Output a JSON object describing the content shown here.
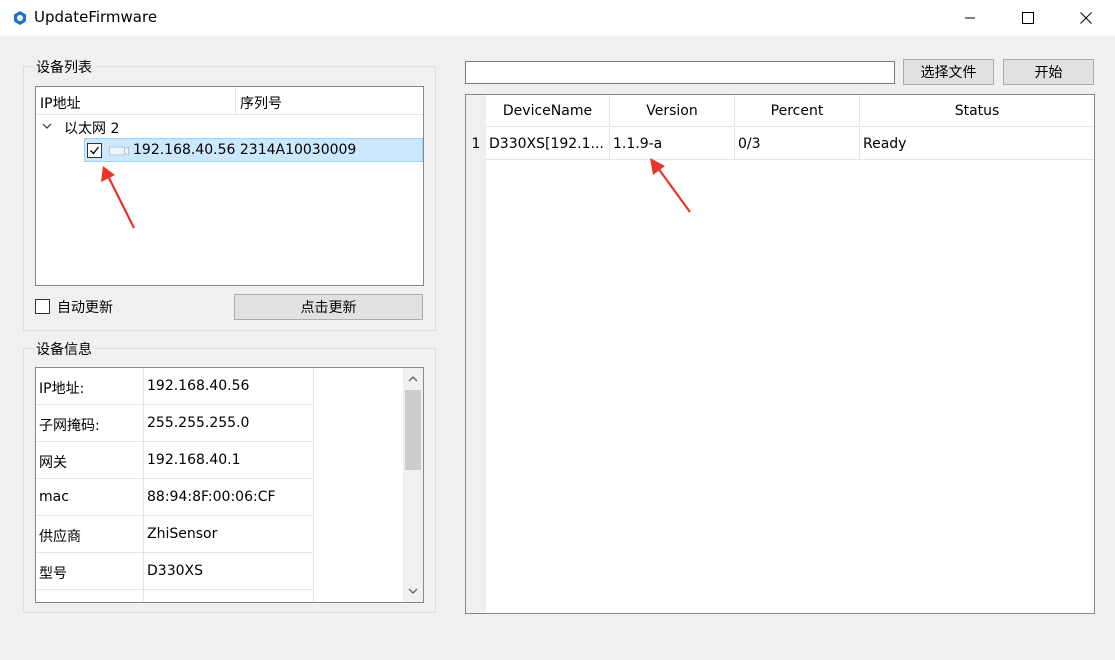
{
  "window": {
    "title": "UpdateFirmware",
    "accent": "#1e73c8"
  },
  "device_list": {
    "group_title": "设备列表",
    "columns": [
      "IP地址",
      "序列号"
    ],
    "network_group": "以太网 2",
    "device": {
      "checked": true,
      "ip": "192.168.40.56",
      "serial": "2314A10030009",
      "text": "192.168.40.56 2314A10030009"
    },
    "auto_update_label": "自动更新",
    "auto_update_checked": false,
    "refresh_button": "点击更新"
  },
  "device_info": {
    "group_title": "设备信息",
    "rows": [
      {
        "key": "IP地址:",
        "value": "192.168.40.56"
      },
      {
        "key": "子网掩码:",
        "value": "255.255.255.0"
      },
      {
        "key": "网关",
        "value": "192.168.40.1"
      },
      {
        "key": "mac",
        "value": "88:94:8F:00:06:CF"
      },
      {
        "key": "供应商",
        "value": "ZhiSensor"
      },
      {
        "key": "型号",
        "value": "D330XS"
      }
    ]
  },
  "firmware": {
    "file_path": "",
    "select_file_button": "选择文件",
    "start_button": "开始",
    "columns": [
      "DeviceName",
      "Version",
      "Percent",
      "Status"
    ],
    "rows": [
      {
        "row_number": "1",
        "device_name": "D330XS[192.1...",
        "version": "1.1.9-a",
        "percent": "0/3",
        "status": "Ready"
      }
    ]
  },
  "annotation_color": "#e8352a"
}
